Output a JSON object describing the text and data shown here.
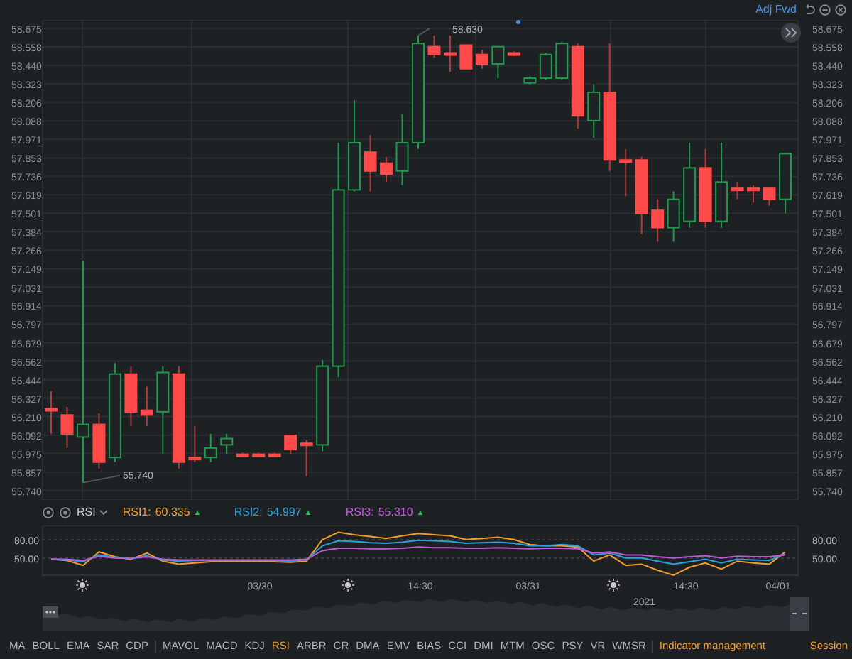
{
  "toolbar": {
    "adjust_label": "Adj Fwd"
  },
  "price_chart": {
    "chart_data": {
      "type": "candlestick",
      "grid": true,
      "ylim": [
        55.68,
        58.73
      ],
      "yticks": [
        {
          "value": 58.675,
          "label": "58.675"
        },
        {
          "value": 58.558,
          "label": "58.558"
        },
        {
          "value": 58.44,
          "label": "58.440"
        },
        {
          "value": 58.323,
          "label": "58.323"
        },
        {
          "value": 58.206,
          "label": "58.206"
        },
        {
          "value": 58.088,
          "label": "58.088"
        },
        {
          "value": 57.971,
          "label": "57.971"
        },
        {
          "value": 57.853,
          "label": "57.853"
        },
        {
          "value": 57.736,
          "label": "57.736"
        },
        {
          "value": 57.619,
          "label": "57.619"
        },
        {
          "value": 57.501,
          "label": "57.501"
        },
        {
          "value": 57.384,
          "label": "57.384"
        },
        {
          "value": 57.266,
          "label": "57.266"
        },
        {
          "value": 57.149,
          "label": "57.149"
        },
        {
          "value": 57.031,
          "label": "57.031"
        },
        {
          "value": 56.914,
          "label": "56.914"
        },
        {
          "value": 56.797,
          "label": "56.797"
        },
        {
          "value": 56.679,
          "label": "56.679"
        },
        {
          "value": 56.562,
          "label": "56.562"
        },
        {
          "value": 56.444,
          "label": "56.444"
        },
        {
          "value": 56.327,
          "label": "56.327"
        },
        {
          "value": 56.21,
          "label": "56.210"
        },
        {
          "value": 56.092,
          "label": "56.092"
        },
        {
          "value": 55.975,
          "label": "55.975"
        },
        {
          "value": 55.857,
          "label": "55.857"
        },
        {
          "value": 55.74,
          "label": "55.740"
        }
      ],
      "ohlc": [
        [
          56.26,
          56.37,
          56.1,
          56.25
        ],
        [
          56.22,
          56.27,
          56.01,
          56.1
        ],
        [
          56.08,
          57.2,
          55.79,
          56.16
        ],
        [
          56.16,
          56.23,
          55.88,
          55.92
        ],
        [
          55.95,
          56.55,
          55.92,
          56.48
        ],
        [
          56.48,
          56.53,
          56.15,
          56.24
        ],
        [
          56.25,
          56.4,
          56.15,
          56.22
        ],
        [
          56.24,
          56.53,
          55.97,
          56.49
        ],
        [
          56.48,
          56.53,
          55.88,
          55.92
        ],
        [
          55.95,
          56.15,
          55.92,
          55.94
        ],
        [
          55.95,
          56.1,
          55.92,
          56.01
        ],
        [
          56.03,
          56.1,
          55.97,
          56.07
        ],
        [
          55.97,
          55.98,
          55.96,
          55.96
        ],
        [
          55.97,
          55.98,
          55.96,
          55.96
        ],
        [
          55.97,
          55.98,
          55.96,
          55.96
        ],
        [
          56.09,
          56.09,
          55.97,
          56.0
        ],
        [
          56.04,
          56.06,
          55.83,
          56.03
        ],
        [
          56.03,
          56.57,
          55.99,
          56.53
        ],
        [
          56.53,
          57.95,
          56.46,
          57.65
        ],
        [
          57.65,
          58.22,
          57.64,
          57.95
        ],
        [
          57.89,
          58.0,
          57.64,
          57.77
        ],
        [
          57.82,
          57.86,
          57.7,
          57.75
        ],
        [
          57.77,
          58.13,
          57.68,
          57.95
        ],
        [
          57.95,
          58.63,
          57.91,
          58.58
        ],
        [
          58.56,
          58.63,
          58.49,
          58.51
        ],
        [
          58.52,
          58.63,
          58.4,
          58.51
        ],
        [
          58.57,
          58.57,
          58.42,
          58.42
        ],
        [
          58.51,
          58.54,
          58.42,
          58.45
        ],
        [
          58.45,
          58.56,
          58.36,
          58.56
        ],
        [
          58.52,
          58.53,
          58.5,
          58.51
        ],
        [
          58.33,
          58.37,
          58.32,
          58.36
        ],
        [
          58.36,
          58.52,
          58.35,
          58.51
        ],
        [
          58.36,
          58.59,
          58.35,
          58.58
        ],
        [
          58.56,
          58.58,
          58.04,
          58.12
        ],
        [
          58.09,
          58.32,
          57.98,
          58.27
        ],
        [
          58.27,
          58.58,
          57.77,
          57.84
        ],
        [
          57.84,
          57.91,
          57.61,
          57.83
        ],
        [
          57.84,
          57.86,
          57.37,
          57.5
        ],
        [
          57.52,
          57.59,
          57.32,
          57.41
        ],
        [
          57.41,
          57.64,
          57.32,
          57.59
        ],
        [
          57.45,
          57.95,
          57.41,
          57.79
        ],
        [
          57.79,
          57.91,
          57.41,
          57.45
        ],
        [
          57.45,
          57.95,
          57.41,
          57.7
        ],
        [
          57.66,
          57.7,
          57.59,
          57.65
        ],
        [
          57.66,
          57.68,
          57.57,
          57.65
        ],
        [
          57.66,
          57.66,
          57.55,
          57.59
        ],
        [
          57.59,
          57.88,
          57.5,
          57.88
        ]
      ],
      "annotations": [
        "58.630",
        "55.740"
      ]
    }
  },
  "rsi_panel": {
    "indicator": "RSI",
    "legend": [
      {
        "value": "60.335"
      },
      {
        "value": "54.997"
      },
      {
        "value": "55.310"
      }
    ],
    "time_labels": [
      "03/30",
      "14:30",
      "03/31",
      "14:30",
      "04/01"
    ],
    "chart_data": {
      "type": "line",
      "grid": true,
      "ylim": [
        22,
        103
      ],
      "yticks": [
        {
          "value": 80,
          "label": "80.00"
        },
        {
          "value": 50,
          "label": "50.00"
        }
      ],
      "series": [
        {
          "name": "RSI1:",
          "color": "#f39c2b",
          "values": [
            48,
            46,
            38,
            60,
            52,
            48,
            58,
            45,
            40,
            42,
            44,
            44,
            44,
            44,
            44,
            43,
            45,
            80,
            92,
            88,
            85,
            82,
            86,
            90,
            88,
            86,
            80,
            82,
            84,
            80,
            72,
            70,
            70,
            68,
            45,
            55,
            38,
            40,
            30,
            22,
            35,
            42,
            32,
            45,
            42,
            40,
            60
          ]
        },
        {
          "name": "RSI2:",
          "color": "#29a3d9",
          "values": [
            48,
            47,
            44,
            55,
            51,
            49,
            54,
            47,
            45,
            46,
            46,
            46,
            46,
            46,
            46,
            45,
            47,
            70,
            78,
            77,
            75,
            74,
            76,
            79,
            78,
            77,
            74,
            75,
            76,
            74,
            70,
            70,
            72,
            70,
            55,
            58,
            50,
            50,
            45,
            40,
            44,
            48,
            42,
            48,
            47,
            46,
            57
          ]
        },
        {
          "name": "RSI3:",
          "color": "#c05ad8",
          "values": [
            48,
            48,
            46,
            53,
            50,
            49,
            52,
            48,
            47,
            47,
            47,
            47,
            47,
            47,
            47,
            47,
            48,
            62,
            66,
            66,
            65,
            65,
            66,
            68,
            67,
            67,
            66,
            66,
            67,
            66,
            65,
            66,
            66,
            65,
            58,
            60,
            55,
            55,
            52,
            50,
            52,
            54,
            50,
            53,
            52,
            52,
            55
          ]
        }
      ]
    }
  },
  "navigator": {
    "year_label": "2021"
  },
  "indicator_bar": {
    "main": [
      {
        "label": "MA",
        "selected": false
      },
      {
        "label": "BOLL",
        "selected": false
      },
      {
        "label": "EMA",
        "selected": false
      },
      {
        "label": "SAR",
        "selected": false
      },
      {
        "label": "CDP",
        "selected": false
      }
    ],
    "sub": [
      {
        "label": "MAVOL",
        "selected": false
      },
      {
        "label": "MACD",
        "selected": false
      },
      {
        "label": "KDJ",
        "selected": false
      },
      {
        "label": "RSI",
        "selected": true
      },
      {
        "label": "ARBR",
        "selected": false
      },
      {
        "label": "CR",
        "selected": false
      },
      {
        "label": "DMA",
        "selected": false
      },
      {
        "label": "EMV",
        "selected": false
      },
      {
        "label": "BIAS",
        "selected": false
      },
      {
        "label": "CCI",
        "selected": false
      },
      {
        "label": "DMI",
        "selected": false
      },
      {
        "label": "MTM",
        "selected": false
      },
      {
        "label": "OSC",
        "selected": false
      },
      {
        "label": "PSY",
        "selected": false
      },
      {
        "label": "VR",
        "selected": false
      },
      {
        "label": "WMSR",
        "selected": false
      }
    ],
    "management": "Indicator management",
    "session": "Session"
  }
}
